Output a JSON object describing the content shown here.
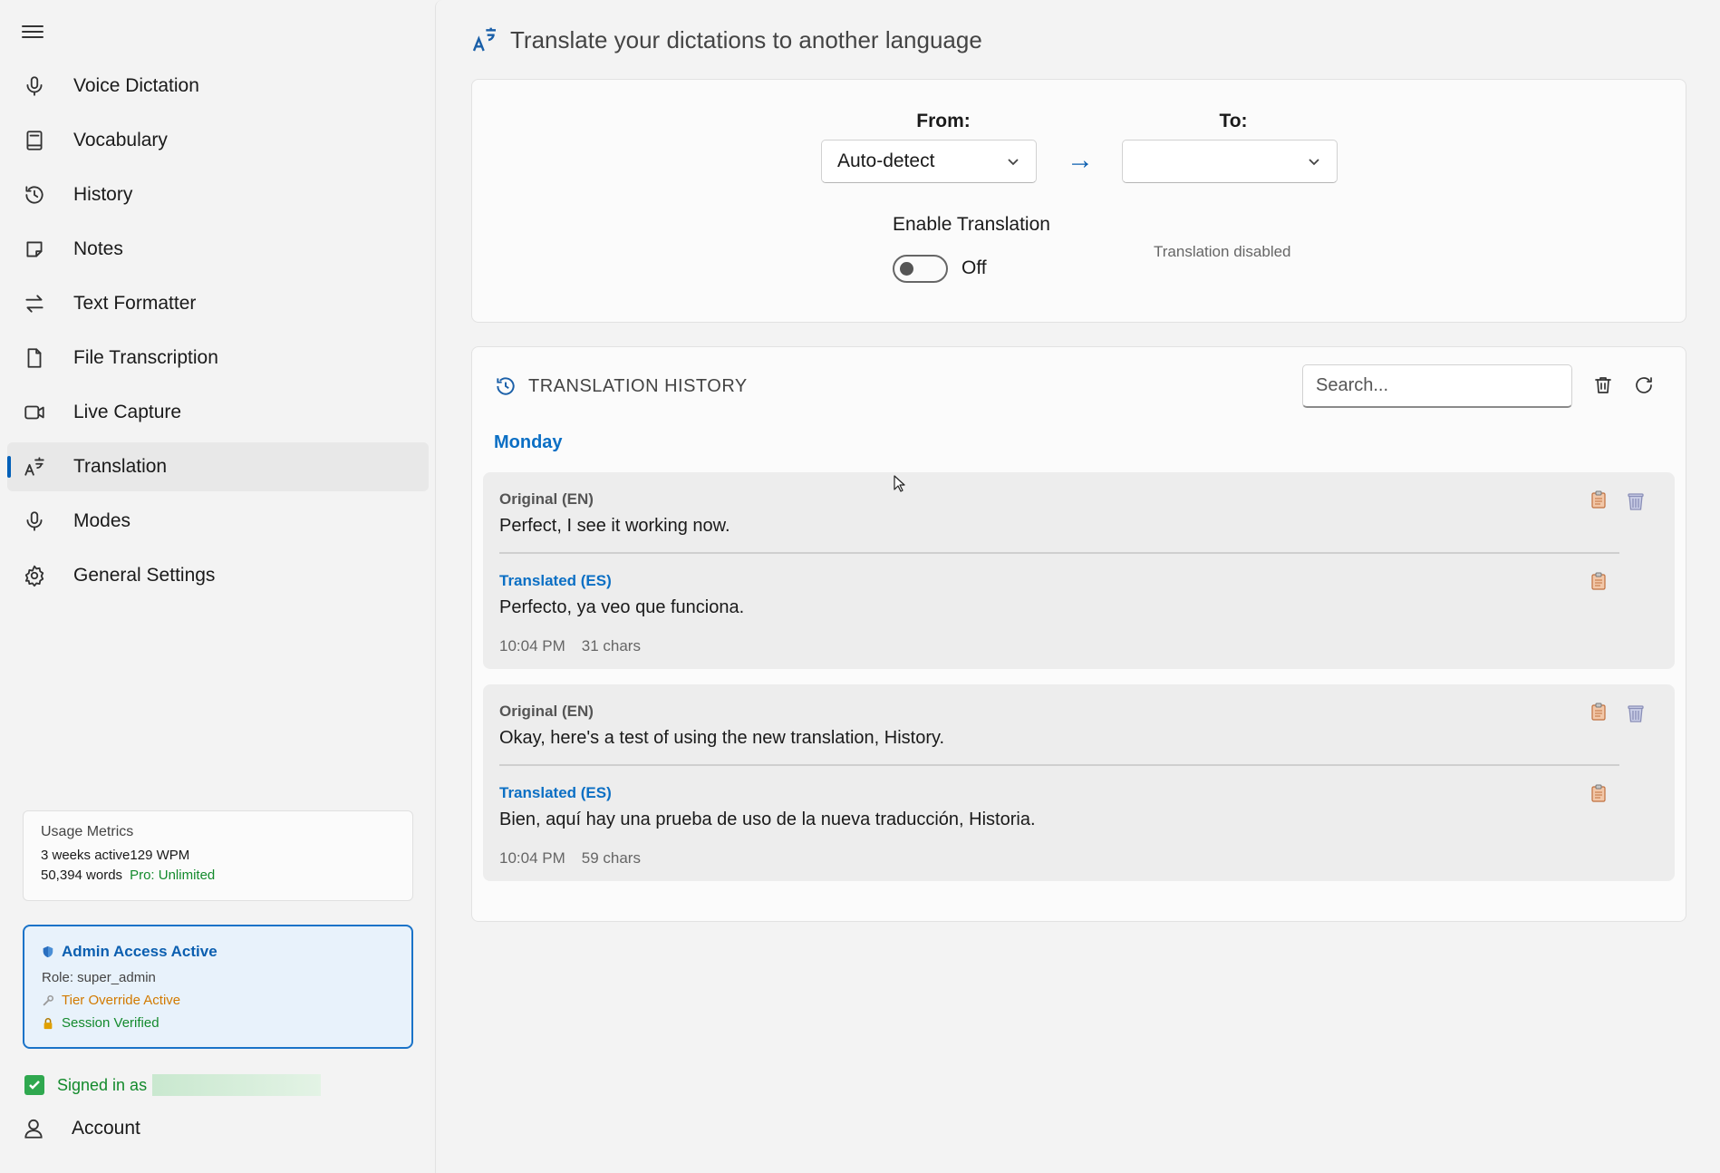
{
  "sidebar": {
    "items": [
      {
        "label": "Voice Dictation",
        "icon": "microphone-icon"
      },
      {
        "label": "Vocabulary",
        "icon": "book-icon"
      },
      {
        "label": "History",
        "icon": "history-icon"
      },
      {
        "label": "Notes",
        "icon": "note-icon"
      },
      {
        "label": "Text Formatter",
        "icon": "swap-arrows-icon"
      },
      {
        "label": "File Transcription",
        "icon": "file-icon"
      },
      {
        "label": "Live Capture",
        "icon": "video-camera-icon"
      },
      {
        "label": "Translation",
        "icon": "translate-icon",
        "active": true
      },
      {
        "label": "Modes",
        "icon": "microphone-icon"
      },
      {
        "label": "General Settings",
        "icon": "gear-icon"
      }
    ],
    "usage": {
      "title": "Usage Metrics",
      "active": "3 weeks active",
      "wpm": "129 WPM",
      "words": "50,394 words",
      "plan": "Pro: Unlimited"
    },
    "admin": {
      "title": "Admin Access Active",
      "role": "Role: super_admin",
      "override": "Tier Override Active",
      "session": "Session Verified"
    },
    "signed_in": "Signed in as",
    "account": "Account"
  },
  "header": {
    "title": "Translate your dictations to another language"
  },
  "settings": {
    "from_label": "From:",
    "from_value": "Auto-detect",
    "to_label": "To:",
    "to_value": "",
    "arrow": "→",
    "enable_label": "Enable Translation",
    "toggle_state": "Off",
    "status": "Translation disabled"
  },
  "history": {
    "title": "TRANSLATION HISTORY",
    "search_placeholder": "Search...",
    "day": "Monday",
    "entries": [
      {
        "orig_label": "Original (EN)",
        "orig_text": "Perfect, I see it working now.",
        "tr_label": "Translated (ES)",
        "tr_text": "Perfecto, ya veo que funciona.",
        "time": "10:04 PM",
        "chars": "31 chars"
      },
      {
        "orig_label": "Original (EN)",
        "orig_text": "Okay, here's a test of using the new translation, History.",
        "tr_label": "Translated (ES)",
        "tr_text": "Bien, aquí hay una prueba de uso de la nueva traducción, Historia.",
        "time": "10:04 PM",
        "chars": "59 chars"
      }
    ]
  },
  "colors": {
    "accent": "#005fb8",
    "success": "#138a2c",
    "warning": "#d27a00"
  }
}
